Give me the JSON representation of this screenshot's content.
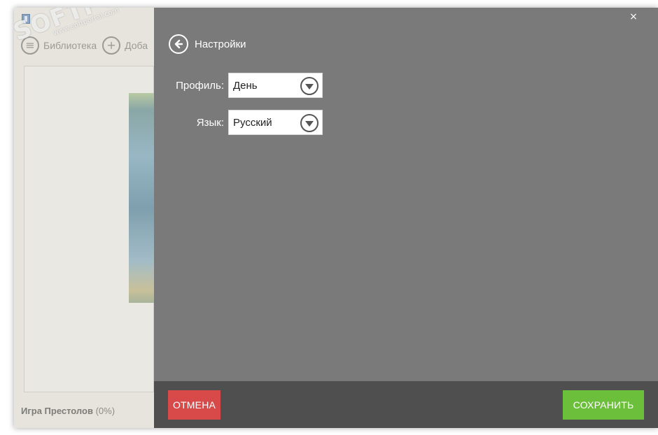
{
  "background_app": {
    "nav": [
      {
        "label": "Библиотека",
        "icon": "book-icon"
      },
      {
        "label": "Доба",
        "icon": "add-icon"
      }
    ],
    "status": {
      "book_title": "Игра Престолов",
      "progress": "(0%)"
    }
  },
  "watermark": {
    "main": "SOFTPORTAL",
    "trademark": "™",
    "sub": "www.softportal.com"
  },
  "settings": {
    "title": "Настройки",
    "close_glyph": "×",
    "profile": {
      "label": "Профиль:",
      "value": "День"
    },
    "language": {
      "label": "Язык:",
      "value": "Русский"
    },
    "cancel_label": "ОТМЕНА",
    "save_label": "СОХРАНИТЬ"
  },
  "colors": {
    "overlay": "#7a7a7a",
    "footer": "#4f4f4f",
    "cancel": "#d84a4a",
    "save": "#6cbf3a"
  }
}
